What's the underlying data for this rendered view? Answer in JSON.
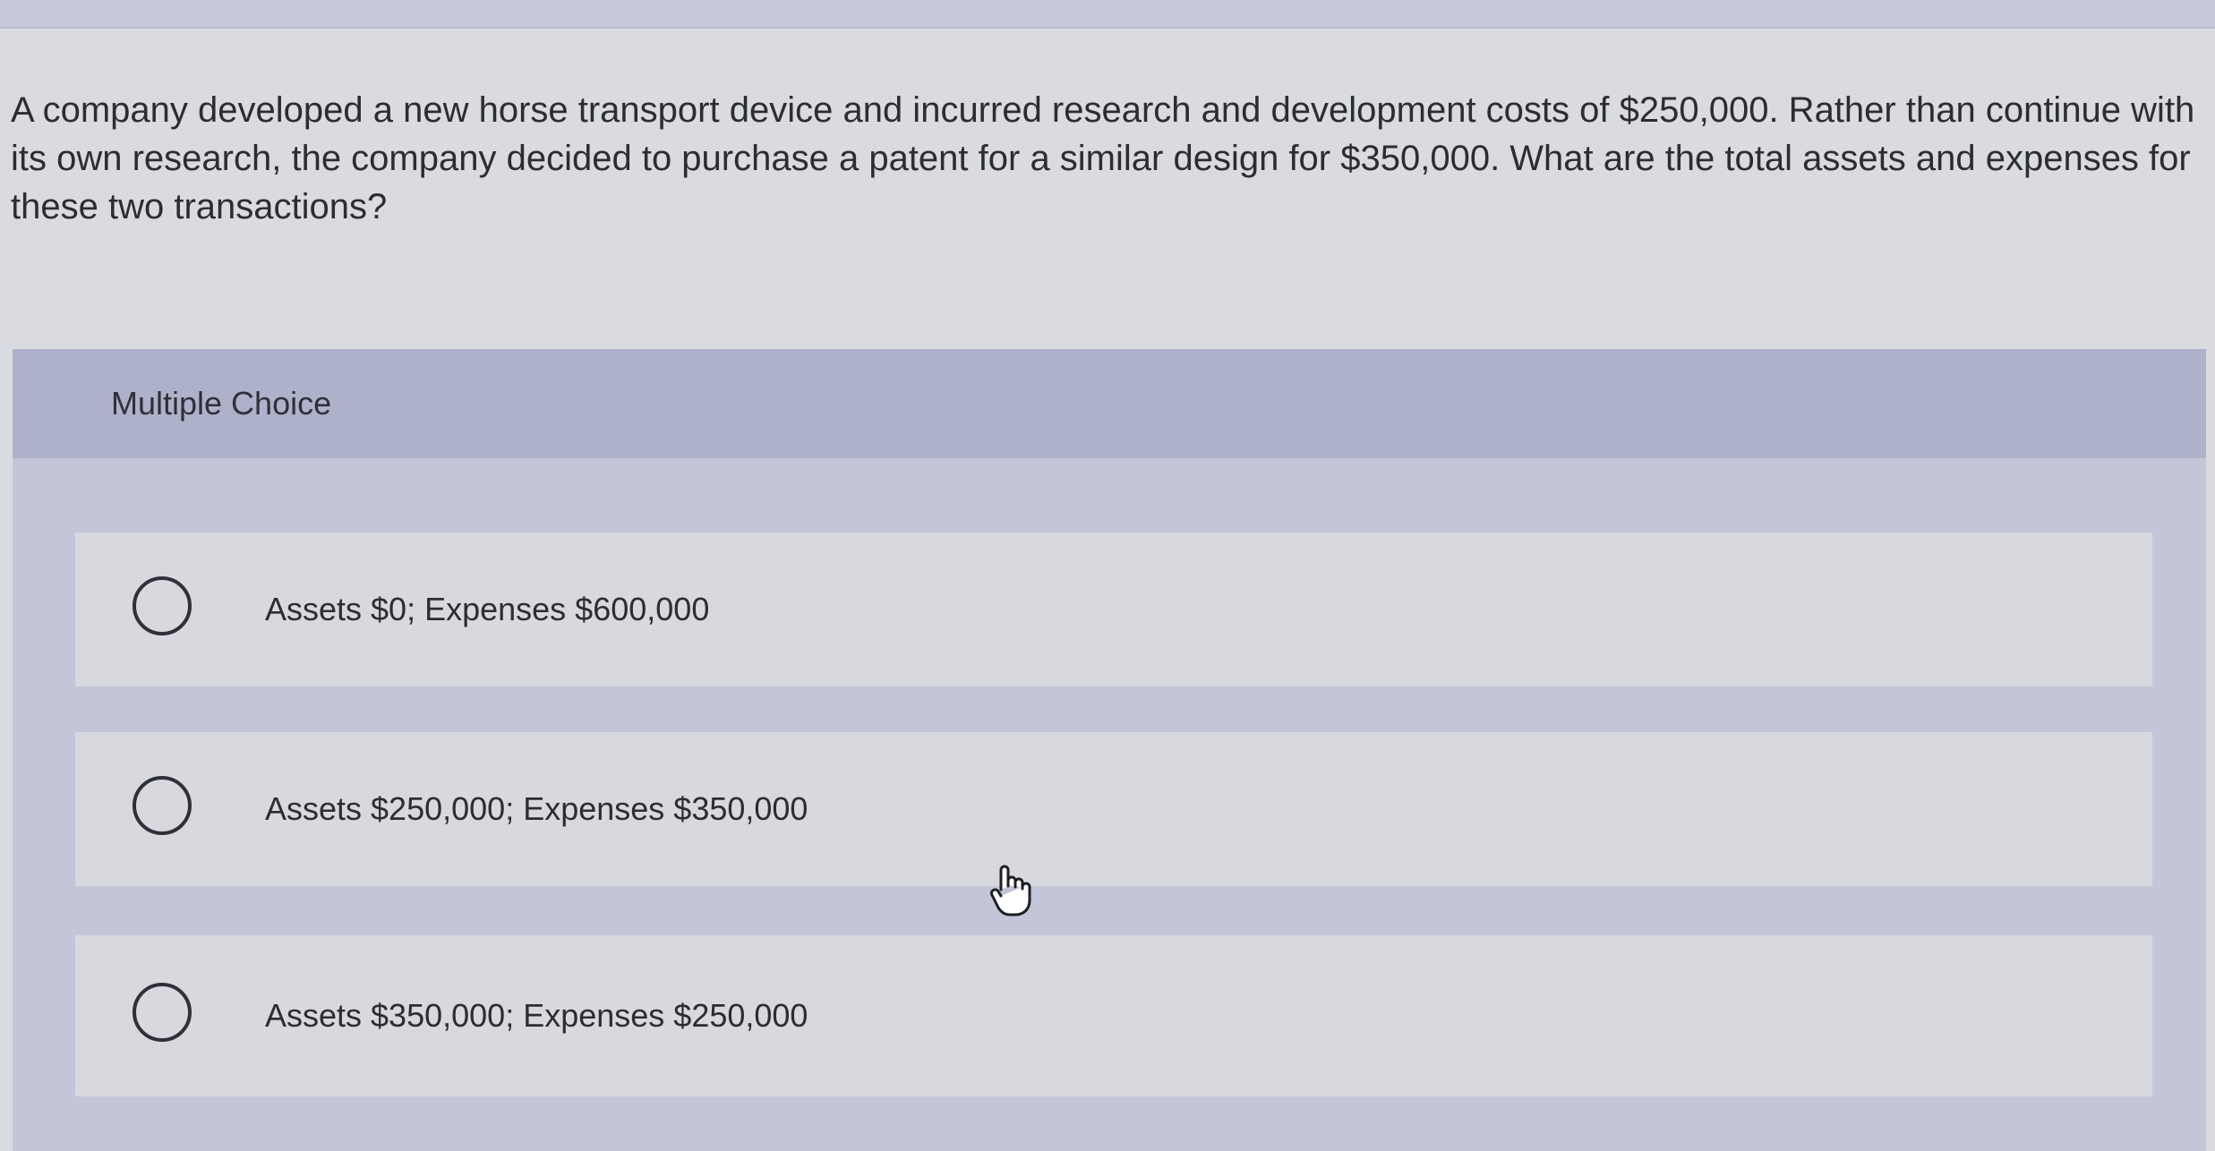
{
  "question": {
    "text": "A company developed a new horse transport device and incurred research and development costs of $250,000. Rather than continue with its own research, the company decided to purchase a patent for a similar design for $350,000. What are the total assets and expenses for these two transactions?"
  },
  "multiple_choice": {
    "title": "Multiple Choice",
    "options": [
      {
        "label": "Assets $0; Expenses $600,000",
        "selected": false
      },
      {
        "label": "Assets $250,000; Expenses $350,000",
        "selected": false
      },
      {
        "label": "Assets $350,000; Expenses $250,000",
        "selected": false
      }
    ]
  },
  "icons": {
    "cursor": "hand-pointer-icon",
    "radio": "radio-unchecked-icon"
  },
  "colors": {
    "background": "#d9dbe0",
    "panel": "#c3c6d8",
    "header": "#aeb1ca",
    "option_bg": "#d7d9df",
    "text": "#2c2d33"
  }
}
